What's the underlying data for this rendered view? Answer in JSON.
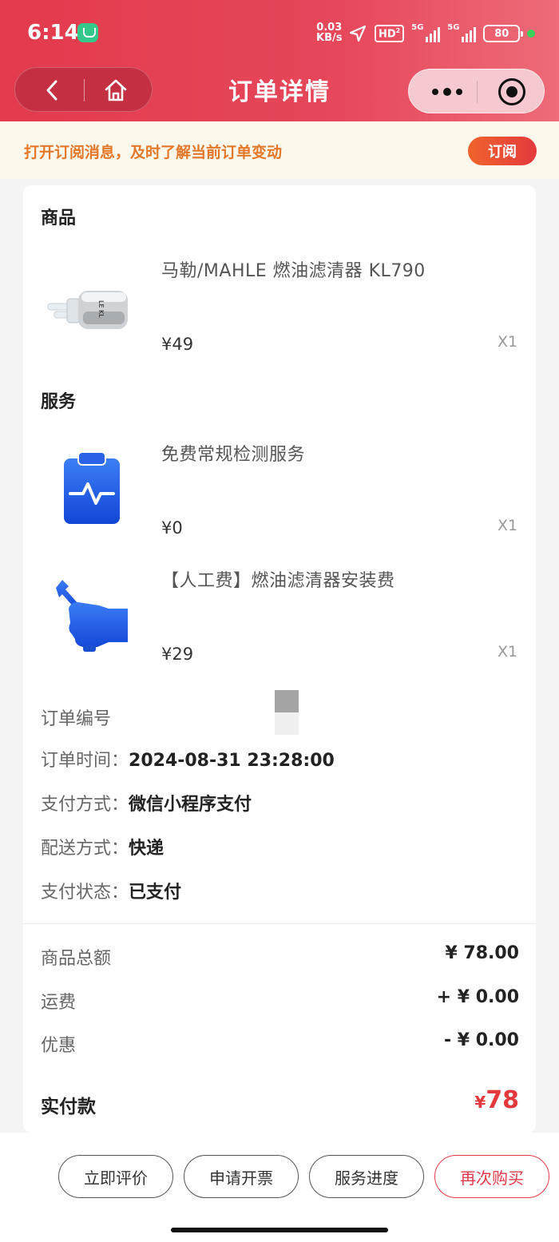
{
  "status_bar": {
    "time": "6:14",
    "net_speed_value": "0.03",
    "net_speed_unit": "KB/s",
    "hd_label": "HD",
    "hd_sub": "2",
    "signal1_label": "5G",
    "signal2_label": "5G",
    "battery": "80"
  },
  "nav": {
    "title": "订单详情"
  },
  "subscribe": {
    "text": "打开订阅消息，及时了解当前订单变动",
    "button": "订阅"
  },
  "goods": {
    "section_title": "商品",
    "items": [
      {
        "name": "马勒/MAHLE 燃油滤清器 KL790",
        "price": "¥49",
        "qty": "X1",
        "icon": "fuel-filter-image"
      }
    ]
  },
  "services": {
    "section_title": "服务",
    "items": [
      {
        "name": "免费常规检测服务",
        "price": "¥0",
        "qty": "X1",
        "icon": "clipboard-pulse-icon"
      },
      {
        "name": "【人工费】燃油滤清器安装费",
        "price": "¥29",
        "qty": "X1",
        "icon": "hand-wrench-icon"
      }
    ]
  },
  "order_info": {
    "number_label": "订单编号",
    "time_label": "订单时间：",
    "time_value": "2024-08-31 23:28:00",
    "pay_method_label": "支付方式：",
    "pay_method_value": "微信小程序支付",
    "delivery_label": "配送方式：",
    "delivery_value": "快递",
    "pay_status_label": "支付状态：",
    "pay_status_value": "已支付"
  },
  "summary": {
    "goods_total_label": "商品总额",
    "goods_total_value": "¥ 78.00",
    "shipping_label": "运费",
    "shipping_value": "+ ¥ 0.00",
    "discount_label": "优惠",
    "discount_value": "- ¥ 0.00",
    "paid_label": "实付款",
    "paid_currency": "¥",
    "paid_amount": "78"
  },
  "actions": {
    "review": "立即评价",
    "invoice": "申请开票",
    "progress": "服务进度",
    "rebuy": "再次购买"
  },
  "colors": {
    "header": "#e33a4d",
    "accent_red": "#e4393c",
    "subscribe_text": "#e3782a",
    "service_icon_blue": "#1f5fe0"
  }
}
